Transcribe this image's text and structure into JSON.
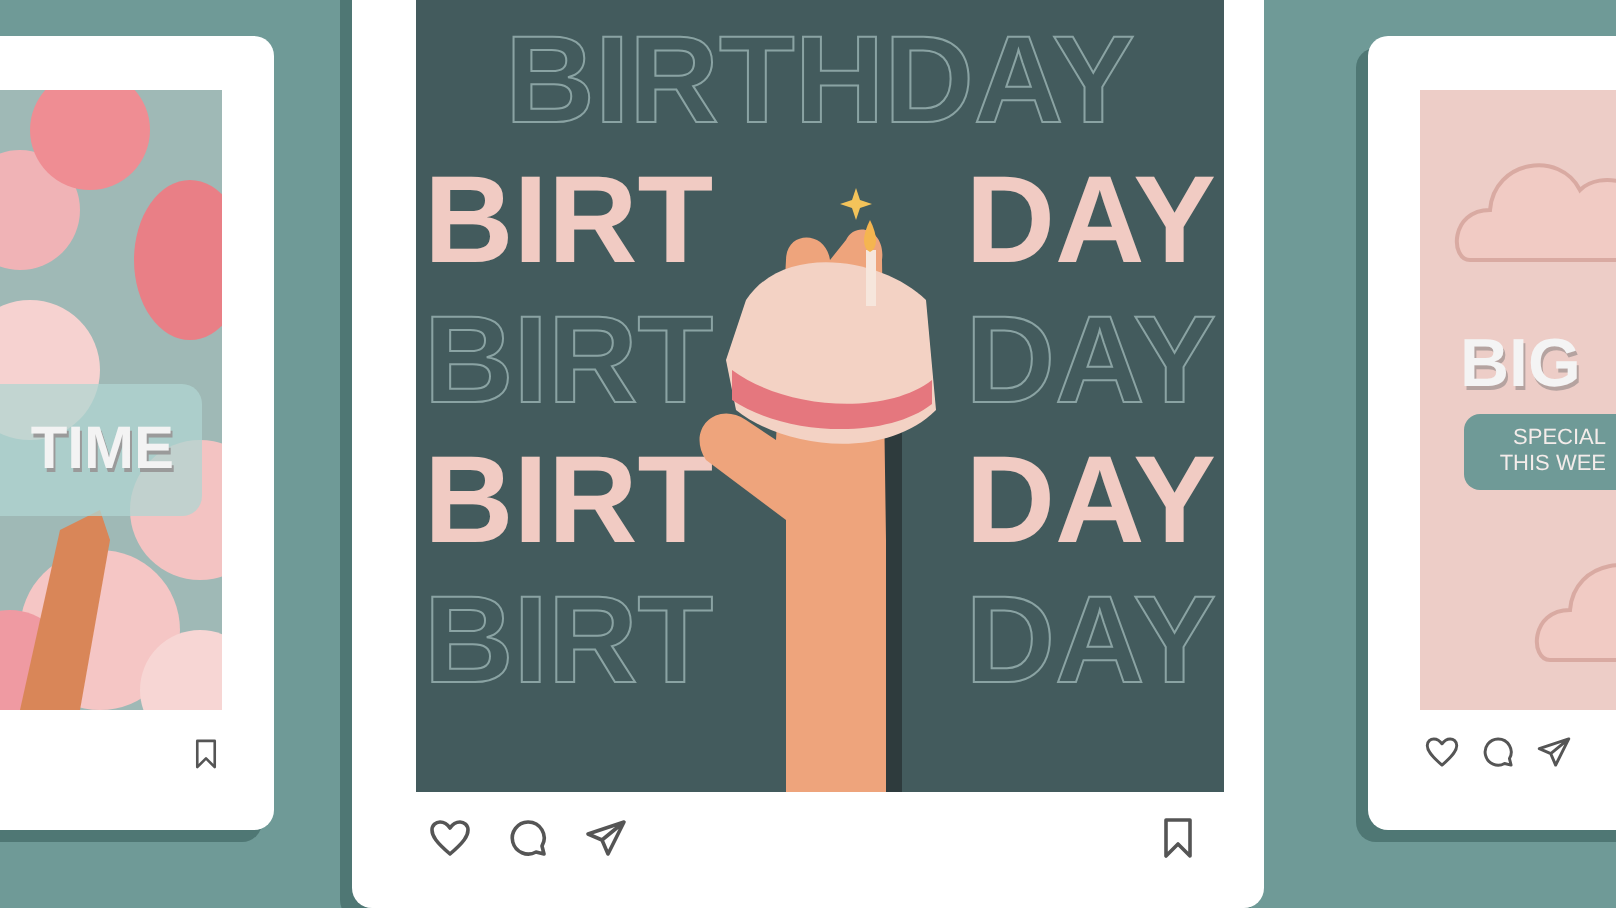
{
  "posts": [
    {
      "kind": "balloons",
      "texts": [
        "TIME"
      ],
      "actions": [
        {
          "kind": "bookmark"
        }
      ]
    },
    {
      "kind": "birthday",
      "lines": [
        {
          "kind": "outline",
          "parts": [
            "BIRTHDAY"
          ]
        },
        {
          "kind": "solid",
          "parts": [
            "BIRT",
            "DAY"
          ]
        },
        {
          "kind": "outline",
          "parts": [
            "BIRT",
            "DAY"
          ]
        },
        {
          "kind": "solid",
          "parts": [
            "BIRT",
            "DAY"
          ]
        },
        {
          "kind": "outline",
          "parts": [
            "BIRT",
            "DAY"
          ]
        }
      ],
      "actions": [
        {
          "kind": "like"
        },
        {
          "kind": "comment"
        },
        {
          "kind": "share"
        },
        {
          "kind": "bookmark"
        }
      ]
    },
    {
      "kind": "clouds",
      "texts": [
        "BIG",
        "SPECIAL",
        "THIS WEE"
      ],
      "actions": [
        {
          "kind": "like"
        },
        {
          "kind": "comment"
        },
        {
          "kind": "share"
        }
      ]
    }
  ]
}
